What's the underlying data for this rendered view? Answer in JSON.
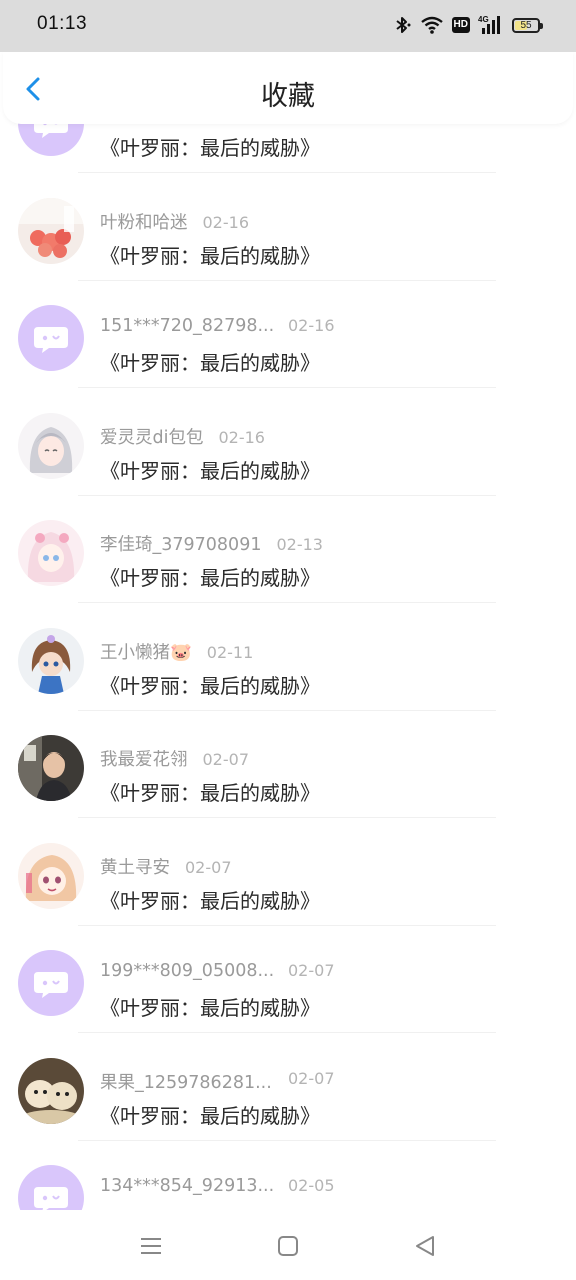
{
  "status_bar": {
    "time": "01:13",
    "battery_level": "55"
  },
  "header": {
    "title": "收藏"
  },
  "book_title": "《叶罗丽：最后的威胁》",
  "items": [
    {
      "user": "",
      "date": "",
      "avatar": "default-purple"
    },
    {
      "user": "叶粉和哈迷",
      "date": "02-16",
      "avatar": "roses-photo"
    },
    {
      "user": "151***720_82798...",
      "date": "02-16",
      "avatar": "default-purple"
    },
    {
      "user": "爱灵灵di包包",
      "date": "02-16",
      "avatar": "anime-girl-silver"
    },
    {
      "user": "李佳琦_379708091",
      "date": "02-13",
      "avatar": "anime-girl-pink"
    },
    {
      "user": "王小懒猪🐷",
      "date": "02-11",
      "avatar": "doll-blue"
    },
    {
      "user": "我最爱花翎",
      "date": "02-07",
      "avatar": "person-photo"
    },
    {
      "user": "黄土寻安",
      "date": "02-07",
      "avatar": "anime-girl-crying"
    },
    {
      "user": "199***809_05008...",
      "date": "02-07",
      "avatar": "default-purple"
    },
    {
      "user": "果果_1259786281...",
      "date": "02-07",
      "avatar": "pets-photo"
    },
    {
      "user": "134***854_92913...",
      "date": "02-05",
      "avatar": "default-purple"
    }
  ],
  "colors": {
    "accent_blue": "#1e90e8",
    "default_avatar_bg": "#d9c6fb",
    "default_avatar_icon": "#ffffff"
  },
  "icons": {
    "back": "chevron-left-icon",
    "menu": "menu-icon",
    "home": "home-square-icon",
    "back_nav": "triangle-back-icon",
    "bluetooth": "bluetooth-icon",
    "wifi": "wifi-icon",
    "hd": "hd-icon",
    "signal": "signal-4g-icon",
    "battery": "battery-icon"
  }
}
